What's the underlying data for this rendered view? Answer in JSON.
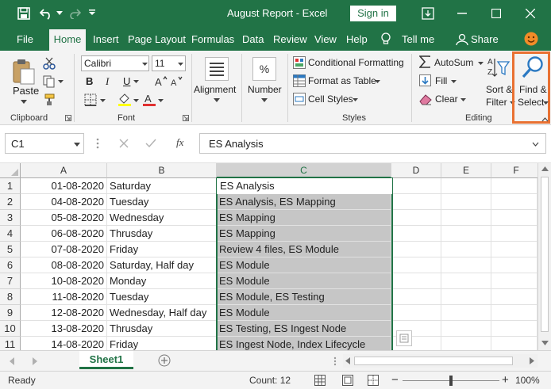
{
  "window": {
    "title": "August Report  -  Excel",
    "signin_label": "Sign in"
  },
  "tabs": [
    "File",
    "Home",
    "Insert",
    "Page Layout",
    "Formulas",
    "Data",
    "Review",
    "View",
    "Help",
    "Tell me",
    "Share"
  ],
  "ribbon": {
    "clipboard": {
      "paste_label": "Paste",
      "group_label": "Clipboard"
    },
    "font": {
      "font_name": "Calibri",
      "font_size": "11",
      "group_label": "Font",
      "bold": "B",
      "italic": "I",
      "underline": "U"
    },
    "alignment_label": "Alignment",
    "number_label": "Number",
    "number_icon": "%",
    "styles": {
      "conditional": "Conditional Formatting",
      "format_table": "Format as Table",
      "cell_styles": "Cell Styles",
      "group_label": "Styles"
    },
    "editing": {
      "autosum": "AutoSum",
      "fill": "Fill",
      "clear": "Clear",
      "sort_filter_line1": "Sort &",
      "sort_filter_line2": "Filter",
      "find_select_line1": "Find &",
      "find_select_line2": "Select",
      "group_label": "Editing"
    }
  },
  "formula_bar": {
    "name_box": "C1",
    "fx": "fx",
    "content": "ES Analysis"
  },
  "columns": [
    "A",
    "B",
    "C",
    "D",
    "E",
    "F"
  ],
  "rows": [
    {
      "n": "1",
      "a": "01-08-2020",
      "b": "Saturday",
      "c": "ES Analysis"
    },
    {
      "n": "2",
      "a": "04-08-2020",
      "b": "Tuesday",
      "c": "ES Analysis, ES Mapping"
    },
    {
      "n": "3",
      "a": "05-08-2020",
      "b": "Wednesday",
      "c": "ES Mapping"
    },
    {
      "n": "4",
      "a": "06-08-2020",
      "b": "Thrusday",
      "c": "ES Mapping"
    },
    {
      "n": "5",
      "a": "07-08-2020",
      "b": "Friday",
      "c": "Review 4 files, ES Module"
    },
    {
      "n": "6",
      "a": "08-08-2020",
      "b": "Saturday, Half day",
      "c": "ES Module"
    },
    {
      "n": "7",
      "a": "10-08-2020",
      "b": "Monday",
      "c": "ES Module"
    },
    {
      "n": "8",
      "a": "11-08-2020",
      "b": "Tuesday",
      "c": "ES Module, ES Testing"
    },
    {
      "n": "9",
      "a": "12-08-2020",
      "b": "Wednesday, Half day",
      "c": "ES Module"
    },
    {
      "n": "10",
      "a": "13-08-2020",
      "b": "Thrusday",
      "c": "ES Testing, ES Ingest Node"
    },
    {
      "n": "11",
      "a": "14-08-2020",
      "b": "Friday",
      "c": "ES Ingest Node, Index Lifecycle"
    }
  ],
  "sheet_tab": "Sheet1",
  "status": {
    "ready": "Ready",
    "count": "Count: 12",
    "zoom": "100%",
    "minus": "−",
    "plus": "+"
  },
  "colors": {
    "accent": "#217346",
    "highlight": "#e97132",
    "selection": "#c6c6c6"
  }
}
